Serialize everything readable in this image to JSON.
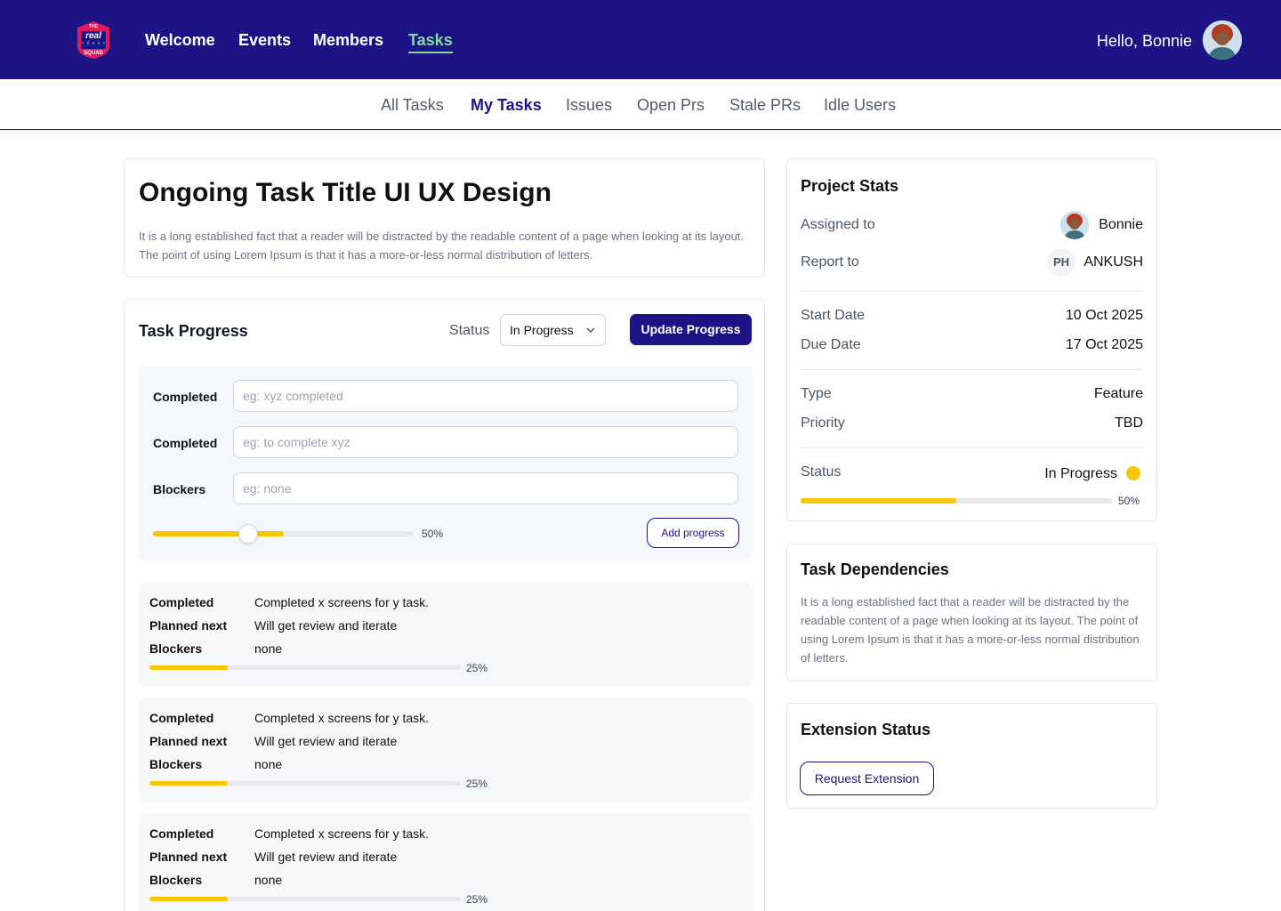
{
  "brand": {
    "logo_top": "THE",
    "logo_main": "real",
    "logo_dev": "< d e v >",
    "logo_bottom": "SQUAD",
    "colors": {
      "navy": "#1c1485",
      "accent_green": "#86d99a",
      "yellow": "#f8c700",
      "logo_red": "#e3195b"
    }
  },
  "topnav": {
    "items": [
      {
        "label": "Welcome",
        "active": false
      },
      {
        "label": "Events",
        "active": false
      },
      {
        "label": "Members",
        "active": false
      },
      {
        "label": "Tasks",
        "active": true
      }
    ],
    "greeting": "Hello, Bonnie",
    "avatar_icon": "user-avatar-icon"
  },
  "subnav": {
    "items": [
      {
        "label": "All Tasks",
        "active": false
      },
      {
        "label": "My Tasks",
        "active": true
      },
      {
        "label": "Issues",
        "active": false
      },
      {
        "label": "Open Prs",
        "active": false
      },
      {
        "label": "Stale PRs",
        "active": false
      },
      {
        "label": "Idle Users",
        "active": false
      }
    ]
  },
  "task": {
    "title": "Ongoing Task Title UI UX Design",
    "description": "It is a long established fact that a reader will be distracted by the readable content of a page when looking at its layout. The point of using Lorem Ipsum is that it has a more-or-less normal distribution of letters."
  },
  "progress": {
    "heading": "Task Progress",
    "status_label": "Status",
    "status_value": "In Progress",
    "update_button": "Update Progress",
    "form": {
      "fields": [
        {
          "label": "Completed",
          "placeholder": "eg: xyz completed"
        },
        {
          "label": "Completed",
          "placeholder": "eg: to complete xyz"
        },
        {
          "label": "Blockers",
          "placeholder": "eg: none"
        }
      ],
      "slider_value": 0.5,
      "slider_label": "50%",
      "add_button": "Add progress"
    },
    "updates": [
      {
        "completed_label": "Completed",
        "completed": "Completed x screens for y task.",
        "planned_label": "Planned next",
        "planned": "Will get review and iterate",
        "blockers_label": "Blockers",
        "blockers": "none",
        "progress": 0.25,
        "progress_label": "25%"
      },
      {
        "completed_label": "Completed",
        "completed": "Completed x screens for y task.",
        "planned_label": "Planned next",
        "planned": "Will get review and iterate",
        "blockers_label": "Blockers",
        "blockers": "none",
        "progress": 0.25,
        "progress_label": "25%"
      },
      {
        "completed_label": "Completed",
        "completed": "Completed x screens for y task.",
        "planned_label": "Planned next",
        "planned": "Will get review and iterate",
        "blockers_label": "Blockers",
        "blockers": "none",
        "progress": 0.25,
        "progress_label": "25%"
      }
    ]
  },
  "stats": {
    "title": "Project Stats",
    "assigned_label": "Assigned to",
    "assigned_value": "Bonnie",
    "report_label": "Report to",
    "report_initials": "PH",
    "report_value": "ANKUSH",
    "start_label": "Start Date",
    "start_value": "10 Oct 2025",
    "due_label": "Due Date",
    "due_value": "17 Oct 2025",
    "type_label": "Type",
    "type_value": "Feature",
    "priority_label": "Priority",
    "priority_value": "TBD",
    "status_label": "Status",
    "status_value": "In Progress",
    "progress": 0.5,
    "progress_label": "50%"
  },
  "dependencies": {
    "title": "Task Dependencies",
    "description": "It is a long established fact that a reader will be distracted by the readable content of a page when looking at its layout. The point of using Lorem Ipsum is that it has a more-or-less normal distribution of letters."
  },
  "extension": {
    "title": "Extension Status",
    "button": "Request Extension"
  }
}
